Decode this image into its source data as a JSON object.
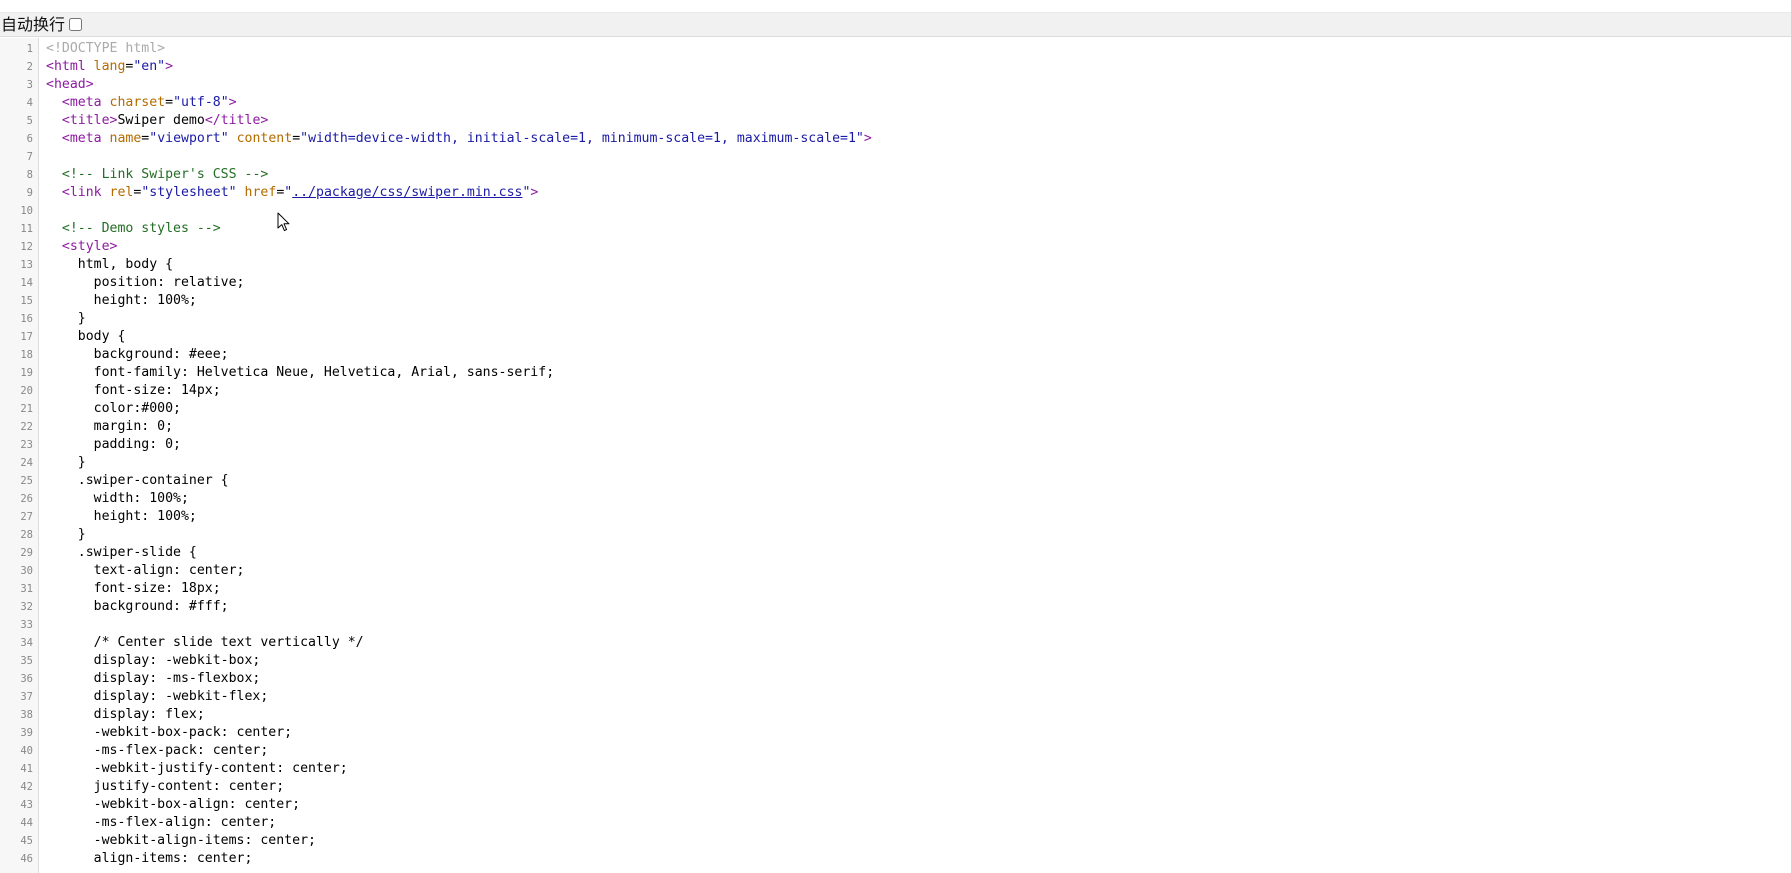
{
  "toolbar": {
    "wrap_label": "自动换行",
    "wrap_checked": false
  },
  "colors": {
    "tag": "#8d1ba0",
    "attribute": "#b36b00",
    "value": "#1a1aa6",
    "comment": "#236e25",
    "doctype": "#aaaaaa",
    "gutter": "#f7f7f7",
    "toolbar": "#f1f1f1"
  },
  "icons": {
    "cursor": "mouse-pointer-icon"
  },
  "code_lines": [
    {
      "n": "1",
      "tokens": [
        [
          "doctype",
          "<!DOCTYPE html>"
        ]
      ]
    },
    {
      "n": "2",
      "tokens": [
        [
          "tag",
          "<html "
        ],
        [
          "attr",
          "lang"
        ],
        [
          "text",
          "="
        ],
        [
          "val",
          "\"en\""
        ],
        [
          "tag",
          ">"
        ]
      ]
    },
    {
      "n": "3",
      "tokens": [
        [
          "tag",
          "<head>"
        ]
      ]
    },
    {
      "n": "4",
      "tokens": [
        [
          "text",
          "  "
        ],
        [
          "tag",
          "<meta "
        ],
        [
          "attr",
          "charset"
        ],
        [
          "text",
          "="
        ],
        [
          "val",
          "\"utf-8\""
        ],
        [
          "tag",
          ">"
        ]
      ]
    },
    {
      "n": "5",
      "tokens": [
        [
          "text",
          "  "
        ],
        [
          "tag",
          "<title>"
        ],
        [
          "text",
          "Swiper demo"
        ],
        [
          "tag",
          "</title>"
        ]
      ]
    },
    {
      "n": "6",
      "tokens": [
        [
          "text",
          "  "
        ],
        [
          "tag",
          "<meta "
        ],
        [
          "attr",
          "name"
        ],
        [
          "text",
          "="
        ],
        [
          "val",
          "\"viewport\""
        ],
        [
          "text",
          " "
        ],
        [
          "attr",
          "content"
        ],
        [
          "text",
          "="
        ],
        [
          "val",
          "\"width=device-width, initial-scale=1, minimum-scale=1, maximum-scale=1\""
        ],
        [
          "tag",
          ">"
        ]
      ]
    },
    {
      "n": "7",
      "tokens": []
    },
    {
      "n": "8",
      "tokens": [
        [
          "text",
          "  "
        ],
        [
          "comment",
          "<!-- Link Swiper's CSS -->"
        ]
      ]
    },
    {
      "n": "9",
      "tokens": [
        [
          "text",
          "  "
        ],
        [
          "tag",
          "<link "
        ],
        [
          "attr",
          "rel"
        ],
        [
          "text",
          "="
        ],
        [
          "val",
          "\"stylesheet\""
        ],
        [
          "text",
          " "
        ],
        [
          "attr",
          "href"
        ],
        [
          "text",
          "="
        ],
        [
          "val",
          "\""
        ],
        [
          "link",
          "../package/css/swiper.min.css"
        ],
        [
          "val",
          "\""
        ],
        [
          "tag",
          ">"
        ]
      ]
    },
    {
      "n": "10",
      "tokens": []
    },
    {
      "n": "11",
      "tokens": [
        [
          "text",
          "  "
        ],
        [
          "comment",
          "<!-- Demo styles -->"
        ]
      ]
    },
    {
      "n": "12",
      "tokens": [
        [
          "text",
          "  "
        ],
        [
          "tag",
          "<style>"
        ]
      ]
    },
    {
      "n": "13",
      "tokens": [
        [
          "text",
          "    html, body {"
        ]
      ]
    },
    {
      "n": "14",
      "tokens": [
        [
          "text",
          "      position: relative;"
        ]
      ]
    },
    {
      "n": "15",
      "tokens": [
        [
          "text",
          "      height: 100%;"
        ]
      ]
    },
    {
      "n": "16",
      "tokens": [
        [
          "text",
          "    }"
        ]
      ]
    },
    {
      "n": "17",
      "tokens": [
        [
          "text",
          "    body {"
        ]
      ]
    },
    {
      "n": "18",
      "tokens": [
        [
          "text",
          "      background: #eee;"
        ]
      ]
    },
    {
      "n": "19",
      "tokens": [
        [
          "text",
          "      font-family: Helvetica Neue, Helvetica, Arial, sans-serif;"
        ]
      ]
    },
    {
      "n": "20",
      "tokens": [
        [
          "text",
          "      font-size: 14px;"
        ]
      ]
    },
    {
      "n": "21",
      "tokens": [
        [
          "text",
          "      color:#000;"
        ]
      ]
    },
    {
      "n": "22",
      "tokens": [
        [
          "text",
          "      margin: 0;"
        ]
      ]
    },
    {
      "n": "23",
      "tokens": [
        [
          "text",
          "      padding: 0;"
        ]
      ]
    },
    {
      "n": "24",
      "tokens": [
        [
          "text",
          "    }"
        ]
      ]
    },
    {
      "n": "25",
      "tokens": [
        [
          "text",
          "    .swiper-container {"
        ]
      ]
    },
    {
      "n": "26",
      "tokens": [
        [
          "text",
          "      width: 100%;"
        ]
      ]
    },
    {
      "n": "27",
      "tokens": [
        [
          "text",
          "      height: 100%;"
        ]
      ]
    },
    {
      "n": "28",
      "tokens": [
        [
          "text",
          "    }"
        ]
      ]
    },
    {
      "n": "29",
      "tokens": [
        [
          "text",
          "    .swiper-slide {"
        ]
      ]
    },
    {
      "n": "30",
      "tokens": [
        [
          "text",
          "      text-align: center;"
        ]
      ]
    },
    {
      "n": "31",
      "tokens": [
        [
          "text",
          "      font-size: 18px;"
        ]
      ]
    },
    {
      "n": "32",
      "tokens": [
        [
          "text",
          "      background: #fff;"
        ]
      ]
    },
    {
      "n": "33",
      "tokens": []
    },
    {
      "n": "34",
      "tokens": [
        [
          "text",
          "      /* Center slide text vertically */"
        ]
      ]
    },
    {
      "n": "35",
      "tokens": [
        [
          "text",
          "      display: -webkit-box;"
        ]
      ]
    },
    {
      "n": "36",
      "tokens": [
        [
          "text",
          "      display: -ms-flexbox;"
        ]
      ]
    },
    {
      "n": "37",
      "tokens": [
        [
          "text",
          "      display: -webkit-flex;"
        ]
      ]
    },
    {
      "n": "38",
      "tokens": [
        [
          "text",
          "      display: flex;"
        ]
      ]
    },
    {
      "n": "39",
      "tokens": [
        [
          "text",
          "      -webkit-box-pack: center;"
        ]
      ]
    },
    {
      "n": "40",
      "tokens": [
        [
          "text",
          "      -ms-flex-pack: center;"
        ]
      ]
    },
    {
      "n": "41",
      "tokens": [
        [
          "text",
          "      -webkit-justify-content: center;"
        ]
      ]
    },
    {
      "n": "42",
      "tokens": [
        [
          "text",
          "      justify-content: center;"
        ]
      ]
    },
    {
      "n": "43",
      "tokens": [
        [
          "text",
          "      -webkit-box-align: center;"
        ]
      ]
    },
    {
      "n": "44",
      "tokens": [
        [
          "text",
          "      -ms-flex-align: center;"
        ]
      ]
    },
    {
      "n": "45",
      "tokens": [
        [
          "text",
          "      -webkit-align-items: center;"
        ]
      ]
    },
    {
      "n": "46",
      "tokens": [
        [
          "text",
          "      align-items: center;"
        ]
      ]
    }
  ]
}
